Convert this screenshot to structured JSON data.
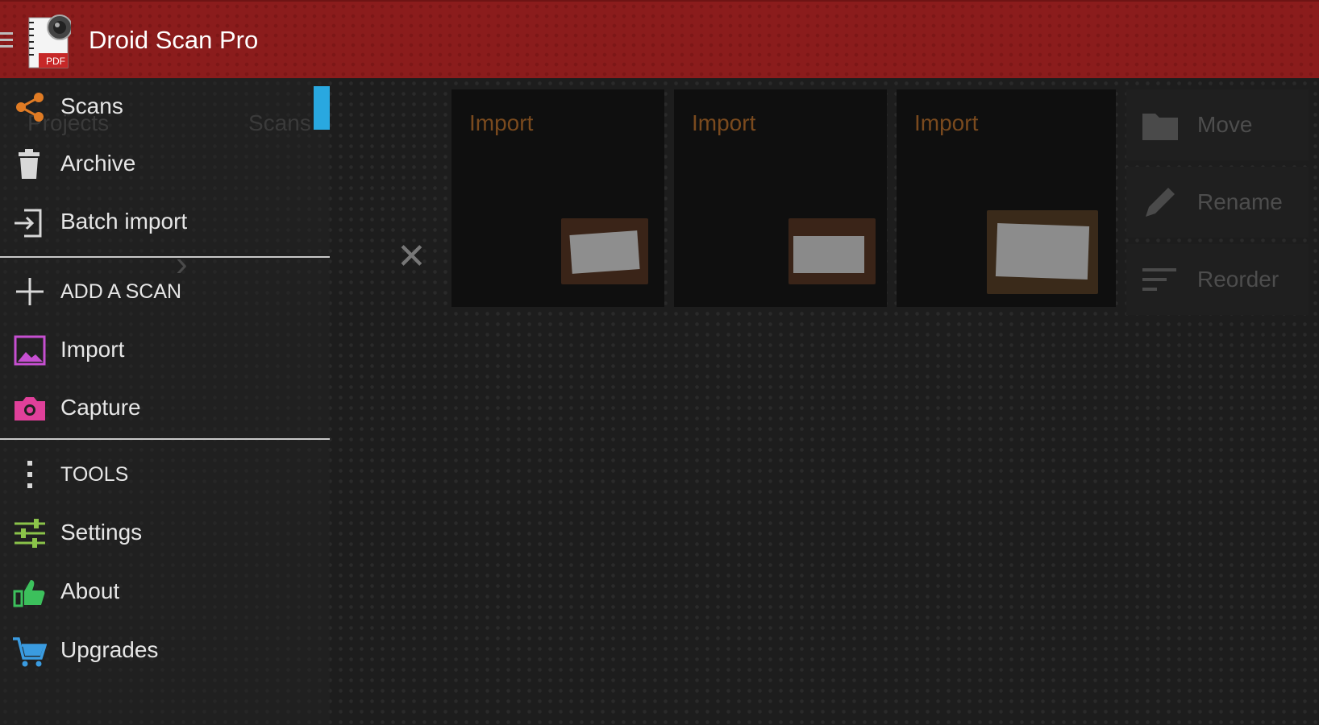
{
  "app": {
    "title": "Droid Scan Pro",
    "icon_name": "pdf-camera-icon",
    "icon_text": "PDF"
  },
  "drawer": {
    "ghost_labels": [
      "Projects",
      "Scans"
    ],
    "items": [
      {
        "label": "Scans",
        "icon": "share-icon"
      },
      {
        "label": "Archive",
        "icon": "trash-icon"
      },
      {
        "label": "Batch import",
        "icon": "import-icon"
      }
    ],
    "section_add": {
      "label": "ADD A SCAN",
      "icon": "plus-icon"
    },
    "add_items": [
      {
        "label": "Import",
        "icon": "image-icon"
      },
      {
        "label": "Capture",
        "icon": "camera-icon"
      }
    ],
    "section_tools": {
      "label": "TOOLS",
      "icon": "more-vert-icon"
    },
    "tool_items": [
      {
        "label": "Settings",
        "icon": "sliders-icon"
      },
      {
        "label": "About",
        "icon": "thumbs-up-icon"
      },
      {
        "label": "Upgrades",
        "icon": "cart-icon"
      }
    ]
  },
  "scans": {
    "cards": [
      {
        "label": "Import"
      },
      {
        "label": "Import"
      },
      {
        "label": "Import"
      }
    ]
  },
  "actions": {
    "move": "Move",
    "rename": "Rename",
    "reorder": "Reorder"
  },
  "colors": {
    "appbar": "#8b1c1c",
    "accent_blue": "#29a8e0",
    "share_orange": "#e07b24",
    "import_purple": "#c64fd1",
    "capture_pink": "#e0409a",
    "settings_green": "#8bc34a",
    "about_green": "#3cc05c",
    "cart_blue": "#3a9be0"
  }
}
